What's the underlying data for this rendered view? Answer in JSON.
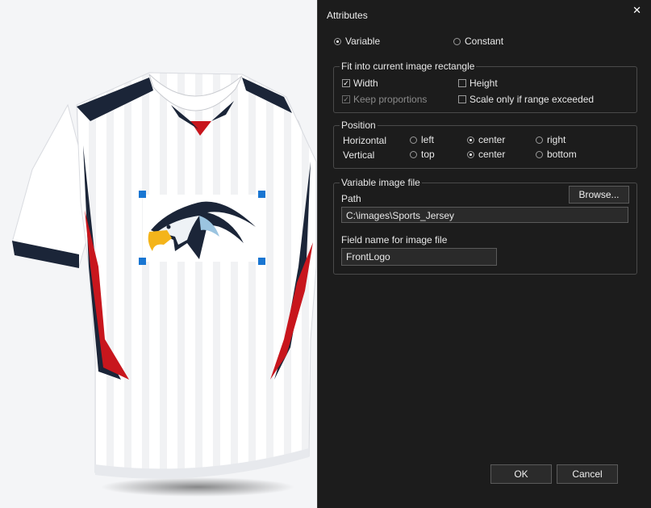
{
  "dialog": {
    "title": "Attributes",
    "close_label": "✕",
    "mode": {
      "variable_label": "Variable",
      "constant_label": "Constant",
      "selected": "variable"
    },
    "fit": {
      "legend": "Fit into current image rectangle",
      "width_label": "Width",
      "width_checked": true,
      "height_label": "Height",
      "height_checked": false,
      "keep_label": "Keep proportions",
      "keep_checked": true,
      "keep_disabled": true,
      "scale_label": "Scale only if range exceeded",
      "scale_checked": false
    },
    "position": {
      "legend": "Position",
      "horizontal_label": "Horizontal",
      "vertical_label": "Vertical",
      "h_left": "left",
      "h_center": "center",
      "h_right": "right",
      "h_selected": "center",
      "v_top": "top",
      "v_center": "center",
      "v_bottom": "bottom",
      "v_selected": "center"
    },
    "file": {
      "legend": "Variable image file",
      "path_label": "Path",
      "browse_label": "Browse...",
      "path_value": "C:\\images\\Sports_Jersey",
      "field_label": "Field name for image file",
      "field_value": "FrontLogo"
    },
    "ok_label": "OK",
    "cancel_label": "Cancel"
  },
  "canvas": {
    "object": "jersey-image",
    "logo": "eagle-logo",
    "selection_color": "#1976d2",
    "accent_red": "#c8161d",
    "accent_navy": "#1b2538"
  }
}
